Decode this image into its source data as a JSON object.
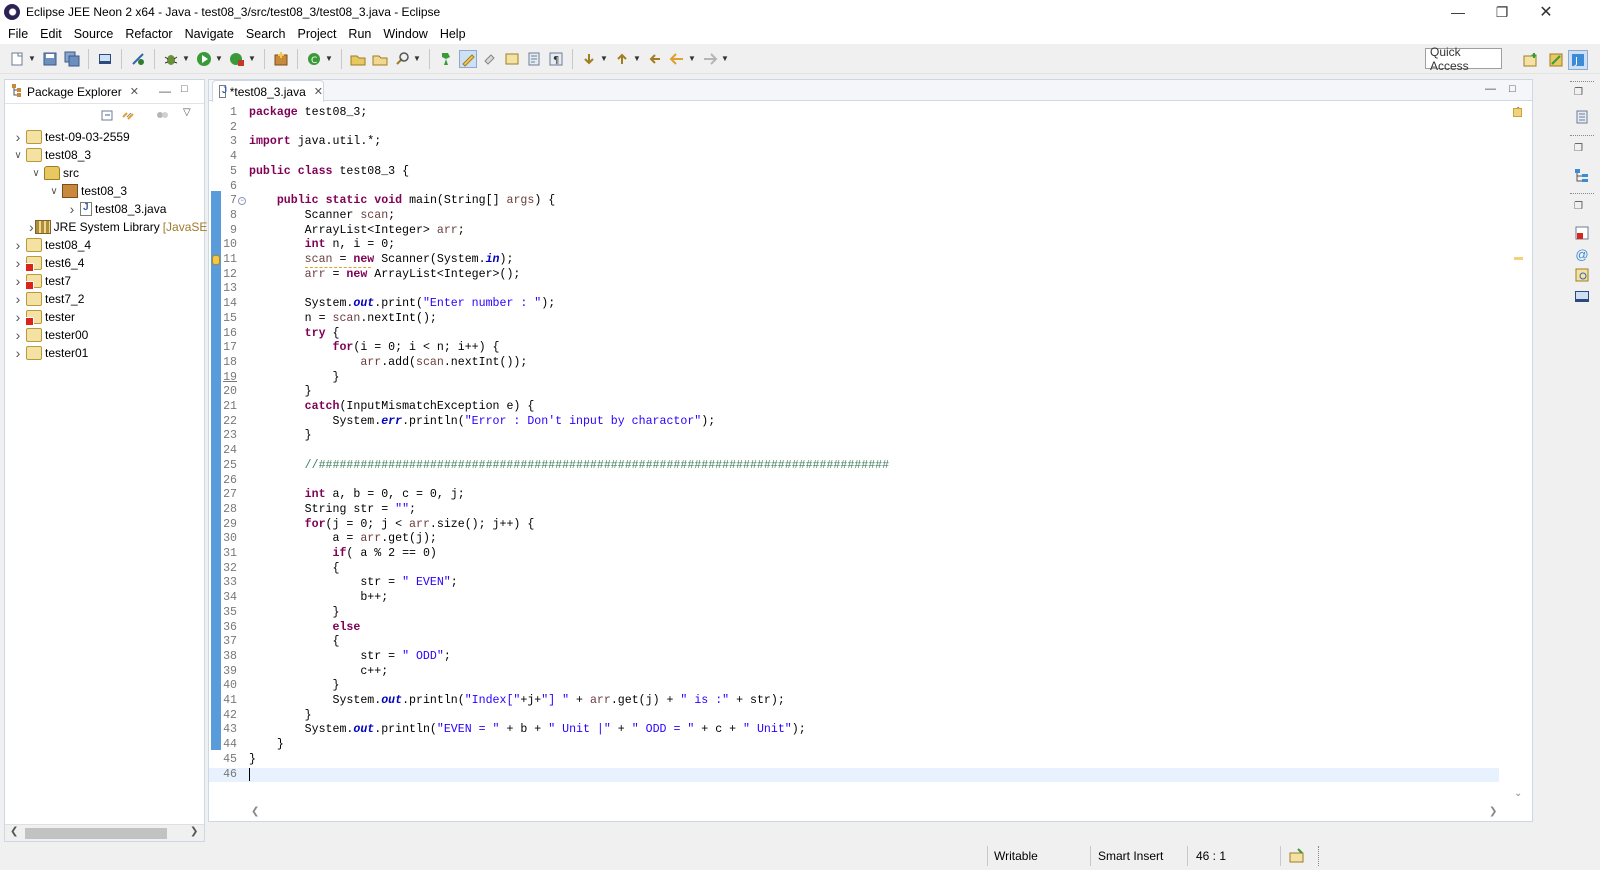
{
  "window": {
    "title": "Eclipse JEE Neon 2 x64 - Java - test08_3/src/test08_3/test08_3.java - Eclipse",
    "controls": [
      "minimize",
      "restore",
      "close"
    ]
  },
  "menu": [
    "File",
    "Edit",
    "Source",
    "Refactor",
    "Navigate",
    "Search",
    "Project",
    "Run",
    "Window",
    "Help"
  ],
  "toolbar": {
    "quick_access": "Quick Access"
  },
  "package_explorer": {
    "title": "Package Explorer",
    "tree": [
      {
        "label": "test-09-03-2559",
        "depth": 0,
        "expanded": false,
        "icon": "project-icon",
        "error": false
      },
      {
        "label": "test08_3",
        "depth": 0,
        "expanded": true,
        "icon": "project-icon",
        "error": false
      },
      {
        "label": "src",
        "depth": 1,
        "expanded": true,
        "icon": "source-folder-icon",
        "error": false
      },
      {
        "label": "test08_3",
        "depth": 2,
        "expanded": true,
        "icon": "package-icon",
        "error": false
      },
      {
        "label": "test08_3.java",
        "depth": 3,
        "expanded": false,
        "icon": "java-file-icon",
        "error": false
      },
      {
        "label": "JRE System Library",
        "suffix": "[JavaSE",
        "depth": 1,
        "expanded": false,
        "icon": "library-icon",
        "error": false
      },
      {
        "label": "test08_4",
        "depth": 0,
        "expanded": false,
        "icon": "project-icon",
        "error": false
      },
      {
        "label": "test6_4",
        "depth": 0,
        "expanded": false,
        "icon": "project-icon",
        "error": true
      },
      {
        "label": "test7",
        "depth": 0,
        "expanded": false,
        "icon": "project-icon",
        "error": true
      },
      {
        "label": "test7_2",
        "depth": 0,
        "expanded": false,
        "icon": "project-icon",
        "error": false
      },
      {
        "label": "tester",
        "depth": 0,
        "expanded": false,
        "icon": "project-icon",
        "error": true
      },
      {
        "label": "tester00",
        "depth": 0,
        "expanded": false,
        "icon": "project-icon",
        "error": false
      },
      {
        "label": "tester01",
        "depth": 0,
        "expanded": false,
        "icon": "project-icon",
        "error": false
      }
    ]
  },
  "editor": {
    "tab_label": "*test08_3.java",
    "current_line": 46,
    "warning_line": 11,
    "underlined_line": 19,
    "fold_line": 7,
    "lines": [
      "package test08_3;",
      "",
      "import java.util.*;",
      "",
      "public class test08_3 {",
      "",
      "    public static void main(String[] args) {",
      "        Scanner scan;",
      "        ArrayList<Integer> arr;",
      "        int n, i = 0;",
      "        scan = new Scanner(System.in);",
      "        arr = new ArrayList<Integer>();",
      "",
      "        System.out.print(\"Enter number : \");",
      "        n = scan.nextInt();",
      "        try {",
      "            for(i = 0; i < n; i++) {",
      "                arr.add(scan.nextInt());",
      "            }",
      "        }",
      "        catch(InputMismatchException e) {",
      "            System.err.println(\"Error : Don't input by charactor\");",
      "        }",
      "",
      "        //##################################################################################",
      "",
      "        int a, b = 0, c = 0, j;",
      "        String str = \"\";",
      "        for(j = 0; j < arr.size(); j++) {",
      "            a = arr.get(j);",
      "            if( a % 2 == 0)",
      "            {",
      "                str = \" EVEN\";",
      "                b++;",
      "            }",
      "            else",
      "            {",
      "                str = \" ODD\";",
      "                c++;",
      "            }",
      "            System.out.println(\"Index[\"+j+\"] \" + arr.get(j) + \" is :\" + str);",
      "        }",
      "        System.out.println(\"EVEN = \" + b + \" Unit |\" + \" ODD = \" + c + \" Unit\");",
      "    }",
      "}",
      ""
    ]
  },
  "status_bar": {
    "writable": "Writable",
    "insert_mode": "Smart Insert",
    "position": "46 : 1"
  }
}
